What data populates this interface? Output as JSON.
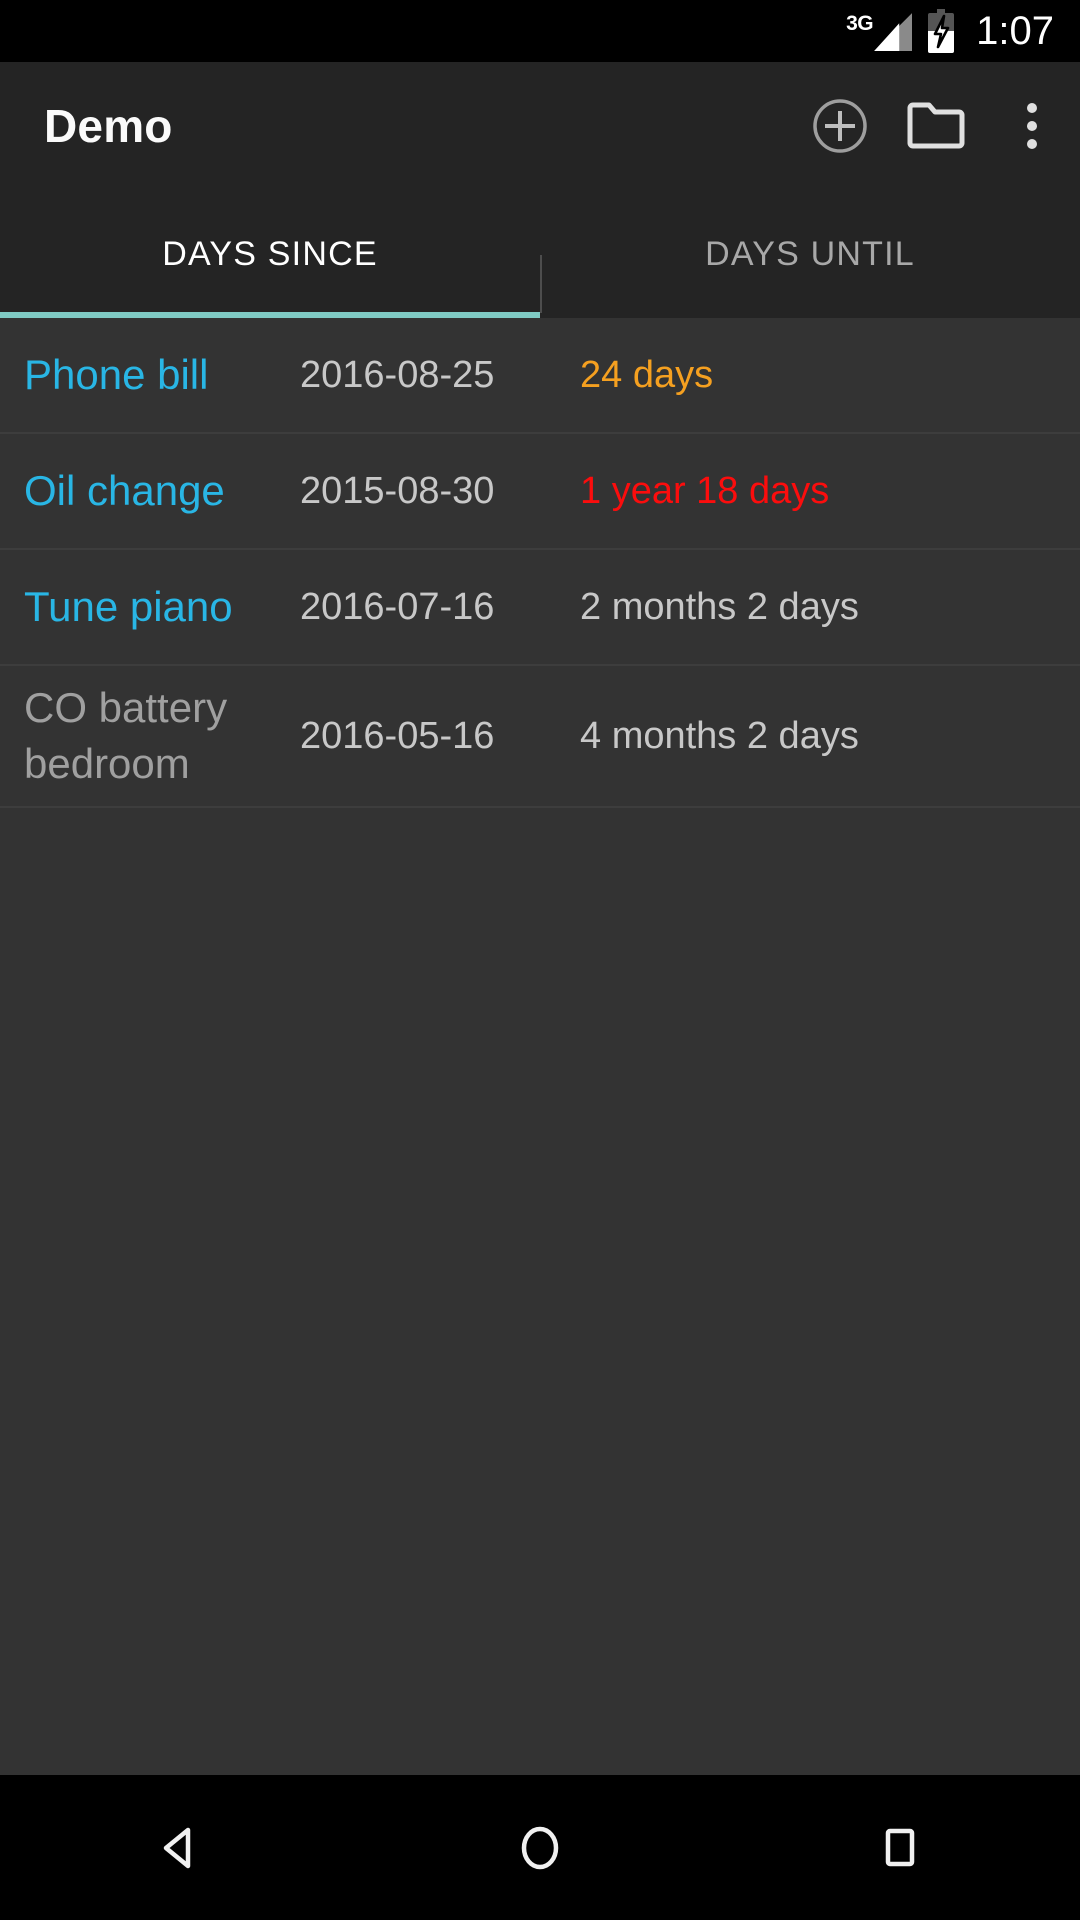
{
  "colors": {
    "accent_teal": "#80cbc4",
    "link_cyan": "#29b6e5",
    "disabled_gray": "#a0a0a0",
    "warn_orange": "#f5a020",
    "alert_red": "#fb0d0d",
    "neutral_gray": "#c8c8c8",
    "appbar_bg": "#242424",
    "list_bg": "#333333",
    "system_black": "#000000"
  },
  "status_bar": {
    "network_label": "3G",
    "signal_icon": "signal-bars-icon",
    "battery_icon": "battery-charging-icon",
    "time": "1:07"
  },
  "app_bar": {
    "title": "Demo",
    "actions": [
      {
        "name": "add-icon",
        "label": "Add"
      },
      {
        "name": "folder-icon",
        "label": "Folder"
      },
      {
        "name": "overflow-menu-icon",
        "label": "More options"
      }
    ]
  },
  "tabs": {
    "items": [
      {
        "label": "DAYS SINCE",
        "active": true
      },
      {
        "label": "DAYS UNTIL",
        "active": false
      }
    ]
  },
  "list": {
    "rows": [
      {
        "name": "Phone bill",
        "date": "2016-08-25",
        "interval": "24 days",
        "name_color": "#29b6e5",
        "interval_color": "#f5a020"
      },
      {
        "name": "Oil change",
        "date": "2015-08-30",
        "interval": "1 year 18 days",
        "name_color": "#29b6e5",
        "interval_color": "#fb0d0d"
      },
      {
        "name": "Tune piano",
        "date": "2016-07-16",
        "interval": "2 months 2 days",
        "name_color": "#29b6e5",
        "interval_color": "#c8c8c8"
      },
      {
        "name": "CO battery bedroom",
        "date": "2016-05-16",
        "interval": "4 months 2 days",
        "name_color": "#a0a0a0",
        "interval_color": "#c8c8c8"
      }
    ]
  },
  "nav_bar": {
    "buttons": [
      {
        "name": "back-icon",
        "label": "Back"
      },
      {
        "name": "home-icon",
        "label": "Home"
      },
      {
        "name": "recents-icon",
        "label": "Recents"
      }
    ]
  }
}
